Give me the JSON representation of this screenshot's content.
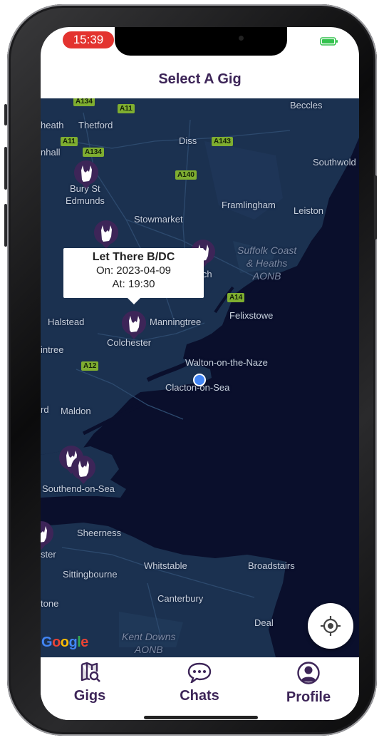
{
  "status_bar": {
    "time": "15:39"
  },
  "header": {
    "title": "Select A Gig"
  },
  "map": {
    "places": [
      {
        "name": "Beccles"
      },
      {
        "name": "heath"
      },
      {
        "name": "Thetford"
      },
      {
        "name": "Diss"
      },
      {
        "name": "Southwold"
      },
      {
        "name": "nhall"
      },
      {
        "name": "Bury St"
      },
      {
        "name": "Edmunds"
      },
      {
        "name": "Framlingham"
      },
      {
        "name": "Leiston"
      },
      {
        "name": "Stowmarket"
      },
      {
        "name": "Halstead"
      },
      {
        "name": "Manningtree"
      },
      {
        "name": "Felixstowe"
      },
      {
        "name": "Colchester"
      },
      {
        "name": "intree"
      },
      {
        "name": "Walton-on-the-Naze"
      },
      {
        "name": "Clacton-on-Sea"
      },
      {
        "name": "rd"
      },
      {
        "name": "Maldon"
      },
      {
        "name": "Southend-on-Sea"
      },
      {
        "name": "Sheerness"
      },
      {
        "name": "ster"
      },
      {
        "name": "Whitstable"
      },
      {
        "name": "Broadstairs"
      },
      {
        "name": "Sittingbourne"
      },
      {
        "name": "Canterbury"
      },
      {
        "name": "tone"
      },
      {
        "name": "Deal"
      },
      {
        "name": "ich"
      }
    ],
    "aonb_labels": [
      "Suffolk Coast",
      "& Heaths",
      "AONB",
      "Kent Downs",
      "AONB"
    ],
    "roads": [
      "A134",
      "A11",
      "A11",
      "A134",
      "A143",
      "A140",
      "A14",
      "A12"
    ],
    "callout": {
      "title": "Let There B/DC",
      "date_line": "On: 2023-04-09",
      "time_line": "At: 19:30"
    },
    "attribution": "Google",
    "colors": {
      "water": "#0a0f2c",
      "land": "#1b3150",
      "marker": "#3d2558"
    }
  },
  "tabs": [
    {
      "label": "Gigs",
      "icon": "map-search-icon"
    },
    {
      "label": "Chats",
      "icon": "chat-bubble-icon"
    },
    {
      "label": "Profile",
      "icon": "user-circle-icon"
    }
  ],
  "colors": {
    "brand": "#3d2558",
    "status_time_bg": "#e3332f"
  }
}
